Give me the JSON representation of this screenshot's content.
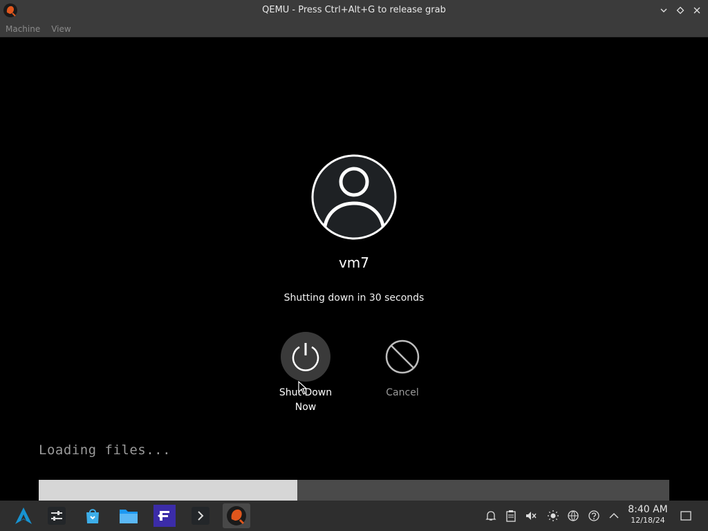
{
  "window": {
    "title": "QEMU - Press Ctrl+Alt+G to release grab",
    "app_icon": "qemu-icon",
    "controls": [
      "minimize-icon",
      "maximize-icon",
      "close-icon"
    ]
  },
  "menubar": {
    "items": [
      "Machine",
      "View"
    ]
  },
  "logout_screen": {
    "username": "vm7",
    "message": "Shutting down in 30 seconds",
    "actions": {
      "shutdown": {
        "label": "Shut Down\nNow",
        "icon": "power-icon"
      },
      "cancel": {
        "label": "Cancel",
        "icon": "cancel-icon"
      }
    }
  },
  "console": {
    "text": "Loading files...",
    "progress": 0.41
  },
  "taskbar": {
    "launcher_icon": "arch-logo-icon",
    "apps": [
      "settings-icon",
      "store-icon",
      "folder-icon",
      "text-editor-icon",
      "terminal-icon",
      "qemu-icon"
    ],
    "tray": [
      "notification-icon",
      "clipboard-icon",
      "volume-muted-icon",
      "brightness-icon",
      "network-icon",
      "help-icon",
      "show-more-icon"
    ],
    "clock": {
      "time": "8:40 AM",
      "date": "12/18/24"
    },
    "show_desktop_icon": "show-desktop-icon"
  },
  "colors": {
    "titlebar": "#3b3b3b",
    "taskbar": "#2e2e2e",
    "progress_fill": "#d6d6d6",
    "progress_track": "#4a4a4a",
    "editor_accent": "#3b2ca8"
  }
}
